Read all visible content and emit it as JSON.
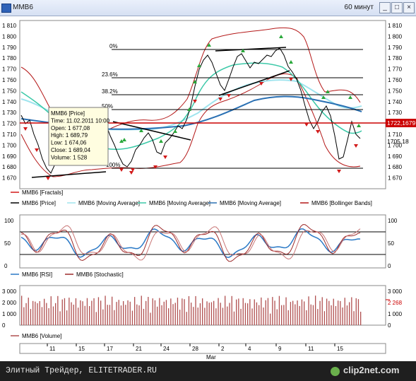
{
  "window": {
    "title": "MMB6",
    "period": "60 минут",
    "minimize": "_",
    "maximize": "□",
    "close": "×"
  },
  "price_axis": {
    "ticks": [
      "1 810",
      "1 800",
      "1 790",
      "1 780",
      "1 770",
      "1 760",
      "1 750",
      "1 740",
      "1 730",
      "1 720",
      "1 710",
      "1 700",
      "1 690",
      "1 680",
      "1 670"
    ],
    "current_price": "1722,1679",
    "current_price_2": "1705,18"
  },
  "fib_levels": [
    "0%",
    "23.6%",
    "38.2%",
    "50%",
    "100%"
  ],
  "tooltip": {
    "lines": [
      "MMB6 [Price]",
      "Time: 11.02.2011 10:00",
      "Open: 1 677,08",
      "High: 1 689,79",
      "Low: 1 674,06",
      "Close: 1 689,04",
      "Volume: 1 528"
    ]
  },
  "legend_main": [
    "MMB6 [Fractals]",
    "MMB6 [Price]",
    "MMB6 [Moving Average]",
    "MMB6 [Moving Average]",
    "MMB6 [Moving Average]",
    "MMB6 [Bollinger Bands]"
  ],
  "osc_axis": {
    "left": [
      "100",
      "50",
      "0"
    ],
    "right": [
      "100",
      "50",
      "0"
    ]
  },
  "legend_osc": [
    "MMB6 [RSI]",
    "MMB6 [Stochastic]"
  ],
  "vol_axis": {
    "left": [
      "3 000",
      "2 000",
      "1 000",
      "0"
    ],
    "right": [
      "3 000",
      "2 268",
      "1 000",
      "0"
    ]
  },
  "legend_vol": [
    "MMB6 [Volume]"
  ],
  "date_axis": {
    "labels": [
      "11",
      "15",
      "17",
      "21",
      "24",
      "28",
      "2",
      "4",
      "9",
      "11",
      "15"
    ],
    "month": "Mar"
  },
  "footer": {
    "caption": "Элитный Трейдер, ELITETRADER.RU",
    "brand": "clip2net.com"
  },
  "colors": {
    "price": "#000000",
    "ma_light": "#9fe4ee",
    "ma_mid": "#3cc9a8",
    "ma_blue": "#2a70b3",
    "bollinger": "#b41818",
    "fractal_up": "#29a83a",
    "fractal_down": "#d21919",
    "rsi": "#2a79c6",
    "stochastic": "#9c2a2a",
    "volume": "#b05050",
    "current_line": "#cc0000"
  }
}
